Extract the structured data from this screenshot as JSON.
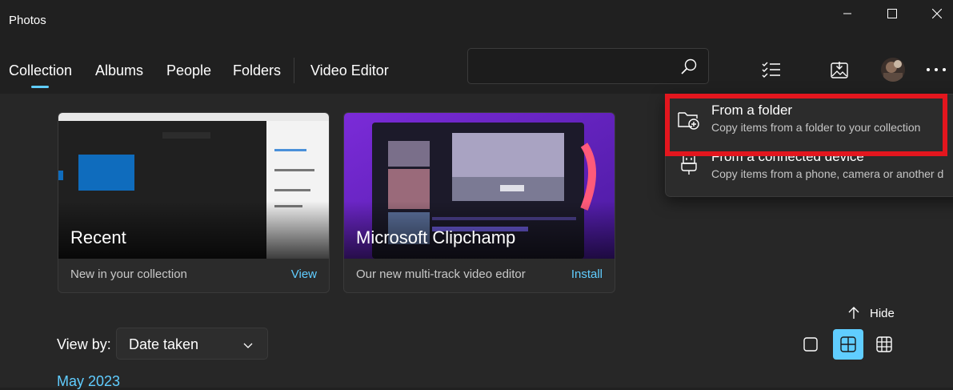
{
  "app": {
    "title": "Photos"
  },
  "nav": {
    "tabs": [
      {
        "label": "Collection",
        "active": true
      },
      {
        "label": "Albums"
      },
      {
        "label": "People"
      },
      {
        "label": "Folders"
      },
      {
        "label": "Video Editor"
      }
    ]
  },
  "search": {
    "placeholder": ""
  },
  "cards": [
    {
      "title": "Recent",
      "desc": "New in your collection",
      "link": "View"
    },
    {
      "title": "Microsoft Clipchamp",
      "desc": "Our new multi-track video editor",
      "link": "Install"
    }
  ],
  "import_menu": {
    "items": [
      {
        "title": "From a folder",
        "subtitle": "Copy items from a folder to your collection",
        "icon": "folder-add-icon"
      },
      {
        "title": "From a connected device",
        "subtitle": "Copy items from a phone, camera or another d",
        "icon": "usb-plug-icon"
      }
    ]
  },
  "toolbar": {
    "hide_label": "Hide"
  },
  "view_by": {
    "label": "View by:",
    "value": "Date taken"
  },
  "timeline": {
    "month": "May 2023"
  },
  "colors": {
    "accent": "#60cdff",
    "highlight": "#e3161e",
    "background": "#202020"
  }
}
